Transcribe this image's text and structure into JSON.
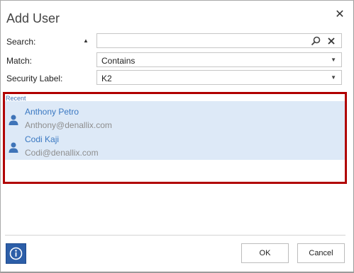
{
  "dialog": {
    "title": "Add User",
    "close_icon": "close-icon"
  },
  "form": {
    "search": {
      "label": "Search:",
      "value": "",
      "placeholder": ""
    },
    "match": {
      "label": "Match:",
      "value": "Contains"
    },
    "security": {
      "label": "Security Label:",
      "value": "K2"
    }
  },
  "recent": {
    "label": "Recent",
    "users": [
      {
        "name": "Anthony Petro",
        "email": "Anthony@denallix.com"
      },
      {
        "name": "Codi Kaji",
        "email": "Codi@denallix.com"
      }
    ]
  },
  "footer": {
    "ok_label": "OK",
    "cancel_label": "Cancel",
    "info_icon": "info-icon"
  },
  "colors": {
    "accent": "#3a78c2",
    "highlight": "#dde9f7",
    "annotation_frame": "#b00000",
    "info_button": "#2c5ea8"
  }
}
